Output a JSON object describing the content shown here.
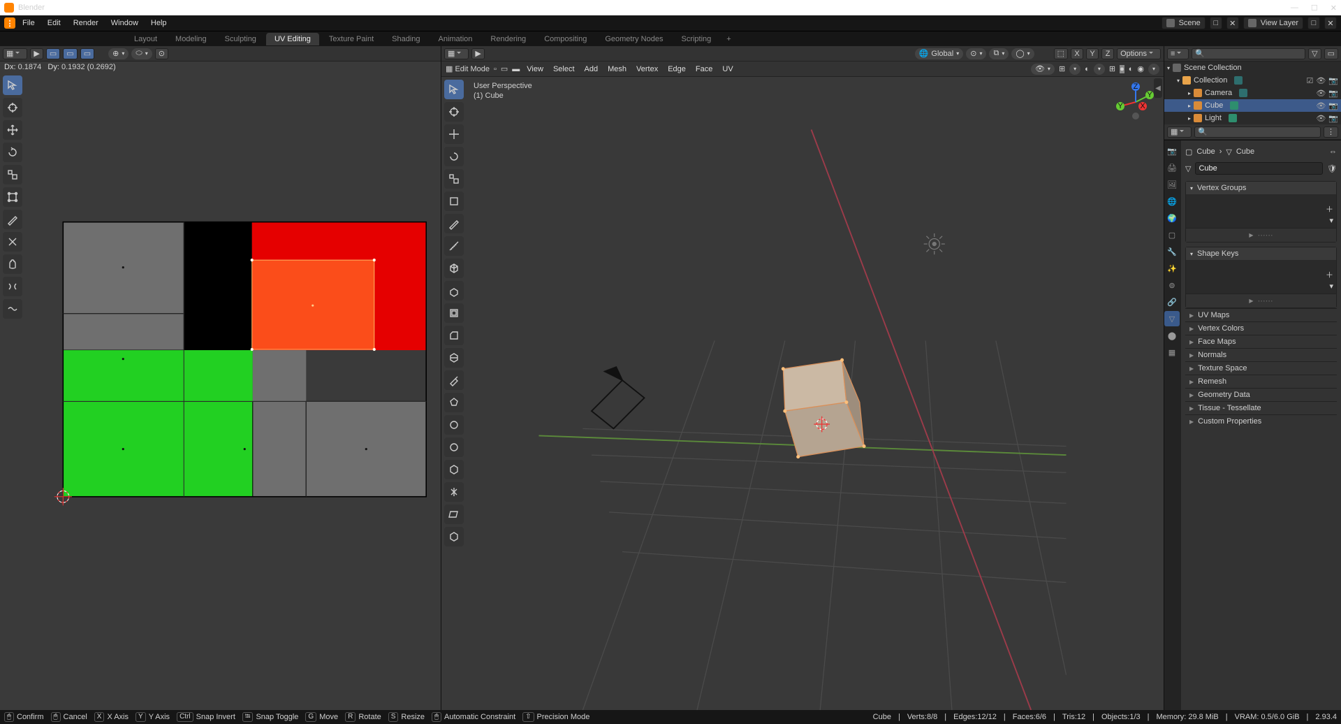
{
  "title_bar": {
    "title": "Blender"
  },
  "menu": {
    "items": [
      "File",
      "Edit",
      "Render",
      "Window",
      "Help"
    ]
  },
  "scene": {
    "scene_name": "Scene",
    "layer_name": "View Layer"
  },
  "workspaces": {
    "tabs": [
      "Layout",
      "Modeling",
      "Sculpting",
      "UV Editing",
      "Texture Paint",
      "Shading",
      "Animation",
      "Rendering",
      "Compositing",
      "Geometry Nodes",
      "Scripting"
    ],
    "active": 3
  },
  "uv_editor": {
    "dx": "0.1874",
    "dy": "0.1932",
    "dlen": "0.2692"
  },
  "viewport": {
    "perspective": "User Perspective",
    "object": "(1) Cube",
    "mode": "Edit Mode",
    "orientation": "Global",
    "options_label": "Options",
    "menus": [
      "View",
      "Select",
      "Add",
      "Mesh",
      "Vertex",
      "Edge",
      "Face",
      "UV"
    ],
    "axes": [
      "X",
      "Y",
      "Z"
    ]
  },
  "outliner": {
    "root": "Scene Collection",
    "collection": "Collection",
    "items": [
      {
        "name": "Camera",
        "icon": "camera"
      },
      {
        "name": "Cube",
        "icon": "mesh",
        "selected": true
      },
      {
        "name": "Light",
        "icon": "light"
      }
    ]
  },
  "properties": {
    "obj_name": "Cube",
    "mesh_name": "Cube",
    "mesh_field": "Cube",
    "sections_open": [
      "Vertex Groups",
      "Shape Keys"
    ],
    "sections_closed": [
      "UV Maps",
      "Vertex Colors",
      "Face Maps",
      "Normals",
      "Texture Space",
      "Remesh",
      "Geometry Data",
      "Tissue - Tessellate",
      "Custom Properties"
    ]
  },
  "status_hints": {
    "confirm": "Confirm",
    "cancel": "Cancel",
    "xaxis": "X Axis",
    "yaxis": "Y Axis",
    "snap_invert": "Snap Invert",
    "snap_toggle": "Snap Toggle",
    "move": "Move",
    "rotate": "Rotate",
    "resize": "Resize",
    "auto": "Automatic Constraint",
    "precision": "Precision Mode"
  },
  "status_right": {
    "obj": "Cube",
    "verts": "Verts:8/8",
    "edges": "Edges:12/12",
    "faces": "Faces:6/6",
    "tris": "Tris:12",
    "objects": "Objects:1/3",
    "memory": "Memory: 29.8 MiB",
    "vram": "VRAM: 0.5/6.0 GiB",
    "version": "2.93.4"
  }
}
